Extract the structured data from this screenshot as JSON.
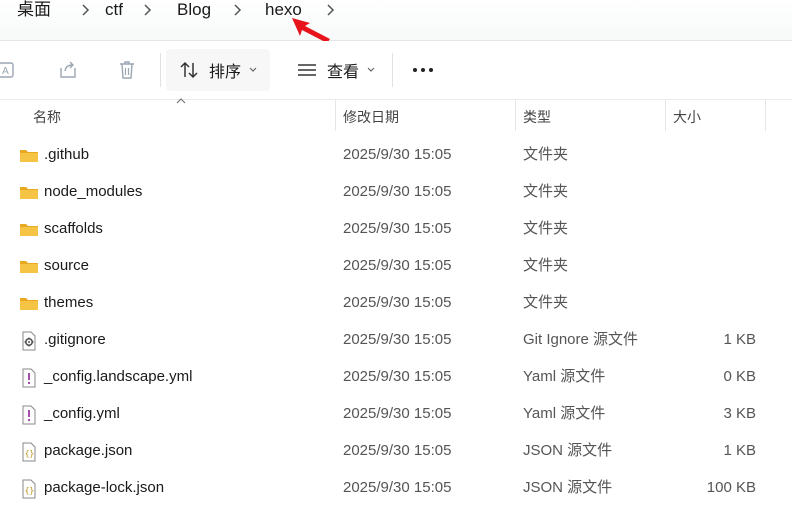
{
  "breadcrumb": [
    "桌面",
    "ctf",
    "Blog",
    "hexo"
  ],
  "toolbar": {
    "sort_label": "排序",
    "view_label": "查看",
    "more_label": "···"
  },
  "columns": {
    "name": "名称",
    "date": "修改日期",
    "type": "类型",
    "size": "大小"
  },
  "files": [
    {
      "name": ".github",
      "date": "2025/9/30 15:05",
      "type": "文件夹",
      "size": "",
      "icon": "folder-icon"
    },
    {
      "name": "node_modules",
      "date": "2025/9/30 15:05",
      "type": "文件夹",
      "size": "",
      "icon": "folder-icon"
    },
    {
      "name": "scaffolds",
      "date": "2025/9/30 15:05",
      "type": "文件夹",
      "size": "",
      "icon": "folder-icon"
    },
    {
      "name": "source",
      "date": "2025/9/30 15:05",
      "type": "文件夹",
      "size": "",
      "icon": "folder-icon"
    },
    {
      "name": "themes",
      "date": "2025/9/30 15:05",
      "type": "文件夹",
      "size": "",
      "icon": "folder-icon"
    },
    {
      "name": ".gitignore",
      "date": "2025/9/30 15:05",
      "type": "Git Ignore 源文件",
      "size": "1 KB",
      "icon": "gear-file-icon"
    },
    {
      "name": "_config.landscape.yml",
      "date": "2025/9/30 15:05",
      "type": "Yaml 源文件",
      "size": "0 KB",
      "icon": "yaml-file-icon"
    },
    {
      "name": "_config.yml",
      "date": "2025/9/30 15:05",
      "type": "Yaml 源文件",
      "size": "3 KB",
      "icon": "yaml-file-icon"
    },
    {
      "name": "package.json",
      "date": "2025/9/30 15:05",
      "type": "JSON 源文件",
      "size": "1 KB",
      "icon": "json-file-icon"
    },
    {
      "name": "package-lock.json",
      "date": "2025/9/30 15:05",
      "type": "JSON 源文件",
      "size": "100 KB",
      "icon": "json-file-icon"
    }
  ],
  "colors": {
    "folder": "#f6c445",
    "folder_dark": "#e8a920",
    "annotation_arrow": "#e8141c"
  }
}
